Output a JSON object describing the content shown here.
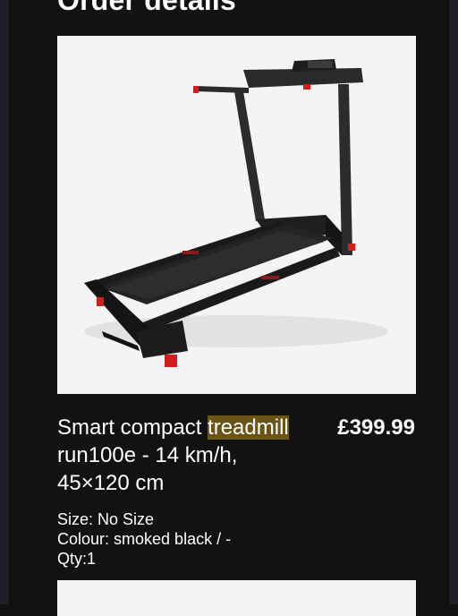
{
  "page": {
    "title": "Order details"
  },
  "product": {
    "image_alt": "treadmill",
    "name_prefix": "Smart compact ",
    "name_highlight": "treadmill",
    "name_suffix": " run100e - 14 km/h, 45×120 cm",
    "price": "£399.99",
    "size": "Size: No Size",
    "colour": "Colour: smoked black / -",
    "qty": "Qty:1"
  },
  "colors": {
    "background": "#121212",
    "highlight": "#6b5416",
    "accent_red": "#d11f1f"
  }
}
